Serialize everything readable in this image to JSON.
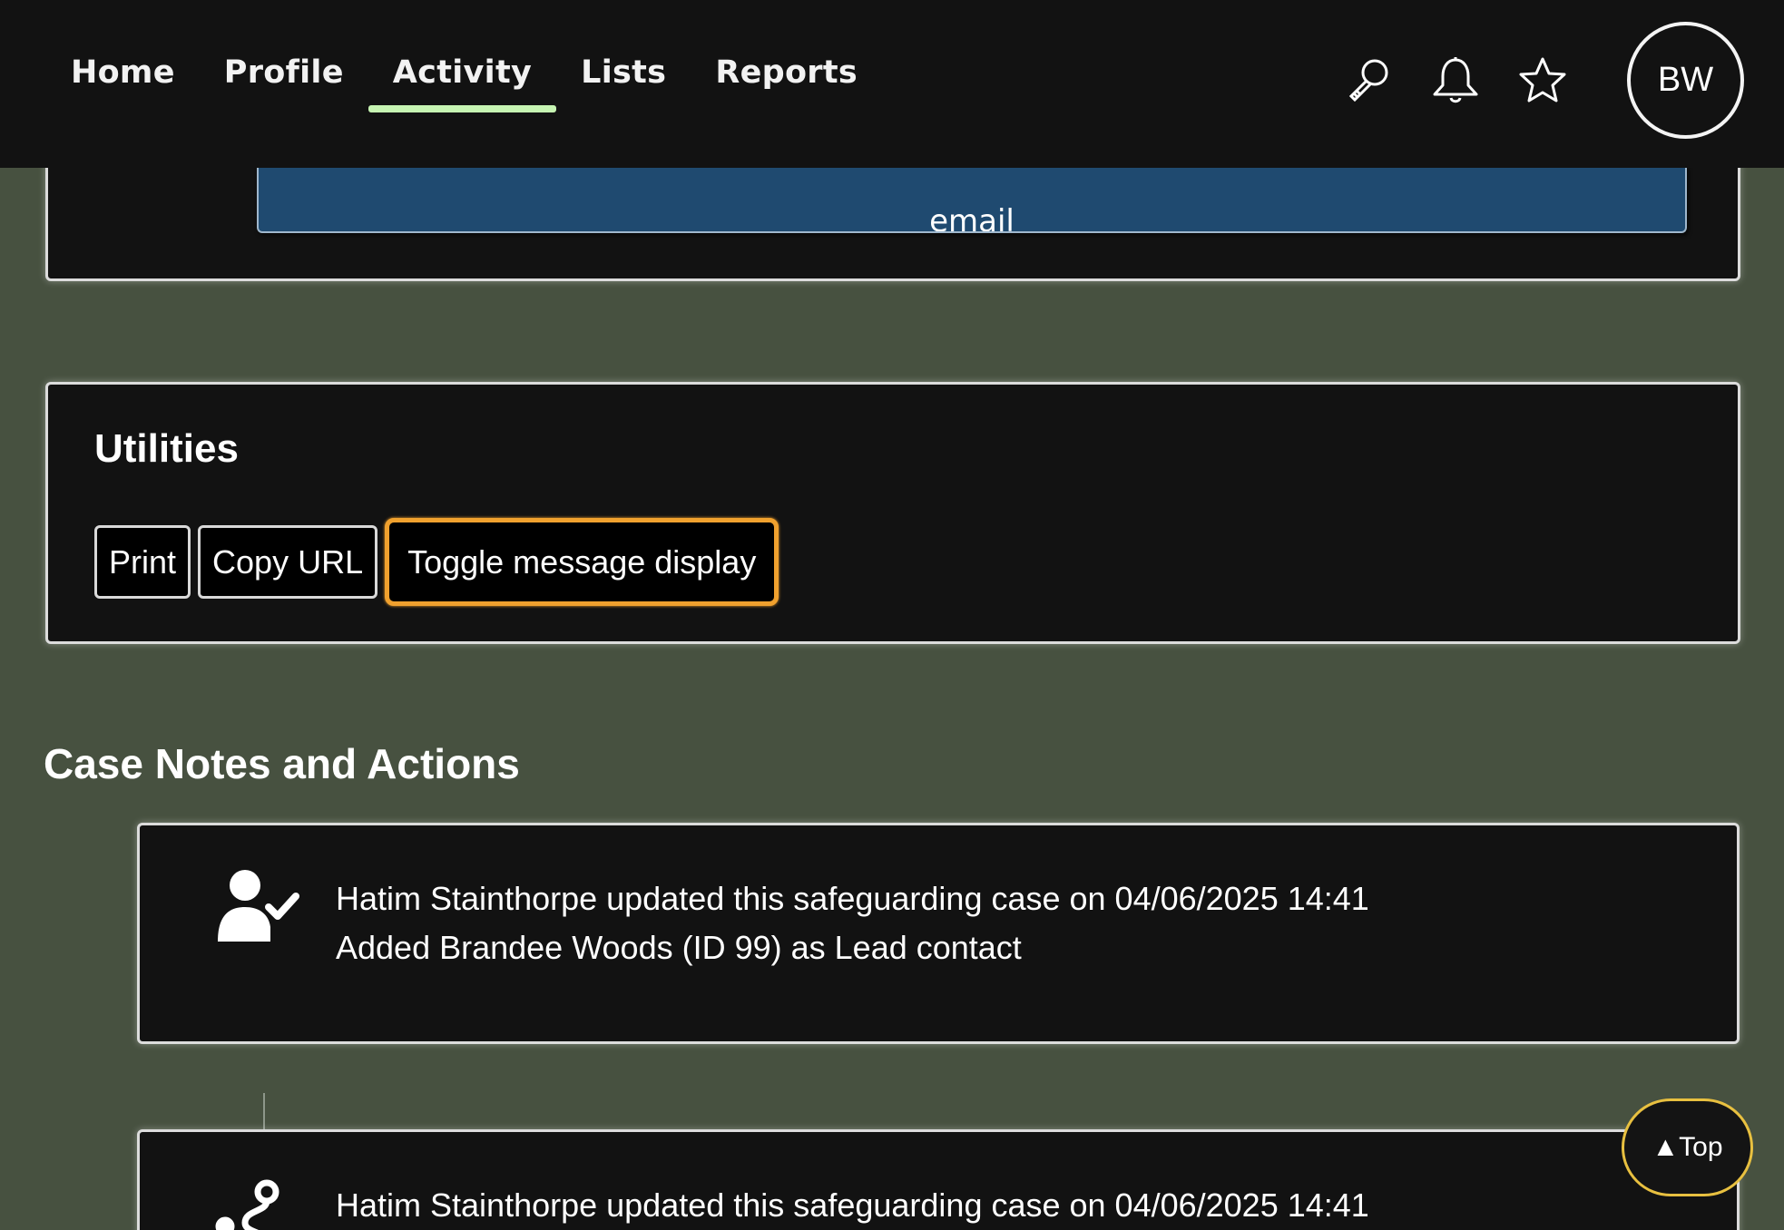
{
  "nav": {
    "items": [
      {
        "label": "Home",
        "active": false
      },
      {
        "label": "Profile",
        "active": false
      },
      {
        "label": "Activity",
        "active": true
      },
      {
        "label": "Lists",
        "active": false
      },
      {
        "label": "Reports",
        "active": false
      }
    ],
    "active_color": "#c6f4b2"
  },
  "header_tools": {
    "search_icon": "search-icon",
    "notifications_icon": "bell-icon",
    "favorites_icon": "star-icon",
    "avatar_initials": "BW"
  },
  "top_card": {
    "email_button_label": "email"
  },
  "utilities": {
    "title": "Utilities",
    "buttons": [
      "Print",
      "Copy URL",
      "Toggle message display"
    ],
    "focus_color": "#f0a12e"
  },
  "case_notes": {
    "heading": "Case Notes and Actions",
    "entries": [
      {
        "icon": "user-check-icon",
        "line1": "Hatim Stainthorpe updated this safeguarding case on 04/06/2025 14:41",
        "line2": "Added Brandee Woods (ID 99) as Lead contact"
      },
      {
        "icon": "route-icon",
        "line1": "Hatim Stainthorpe updated this safeguarding case on 04/06/2025 14:41"
      }
    ]
  },
  "back_to_top": {
    "label": "▲Top",
    "border_color": "#e8c040"
  },
  "colors": {
    "page_background": "#475140",
    "card_background": "#121212",
    "email_button": "#1f4a70"
  }
}
